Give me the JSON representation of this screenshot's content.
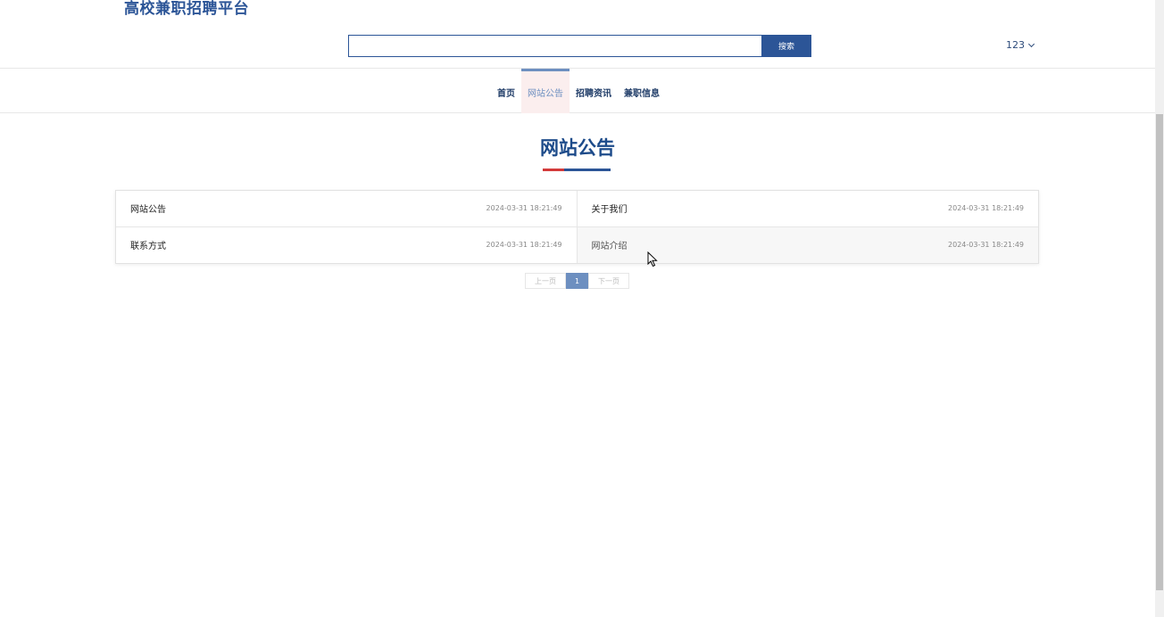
{
  "header": {
    "brand": "高校兼职招聘平台",
    "search": {
      "value": "",
      "placeholder": "",
      "button_label": "搜索"
    },
    "user": {
      "name": "123",
      "icon": "chevron-down-icon"
    }
  },
  "nav": {
    "items": [
      {
        "label": "首页",
        "active": false
      },
      {
        "label": "网站公告",
        "active": true
      },
      {
        "label": "招聘资讯",
        "active": false
      },
      {
        "label": "兼职信息",
        "active": false
      }
    ]
  },
  "section": {
    "title": "网站公告"
  },
  "notices": [
    {
      "title": "网站公告",
      "date": "2024-03-31 18:21:49"
    },
    {
      "title": "关于我们",
      "date": "2024-03-31 18:21:49"
    },
    {
      "title": "联系方式",
      "date": "2024-03-31 18:21:49"
    },
    {
      "title": "网站介绍",
      "date": "2024-03-31 18:21:49"
    }
  ],
  "pagination": {
    "prev": "上一页",
    "current": "1",
    "next": "下一页"
  },
  "colors": {
    "brand": "#2c5597",
    "nav_active": "#6d8fc0",
    "nav_active_bg": "#fbeeee",
    "accent_red": "#d33a3a"
  }
}
